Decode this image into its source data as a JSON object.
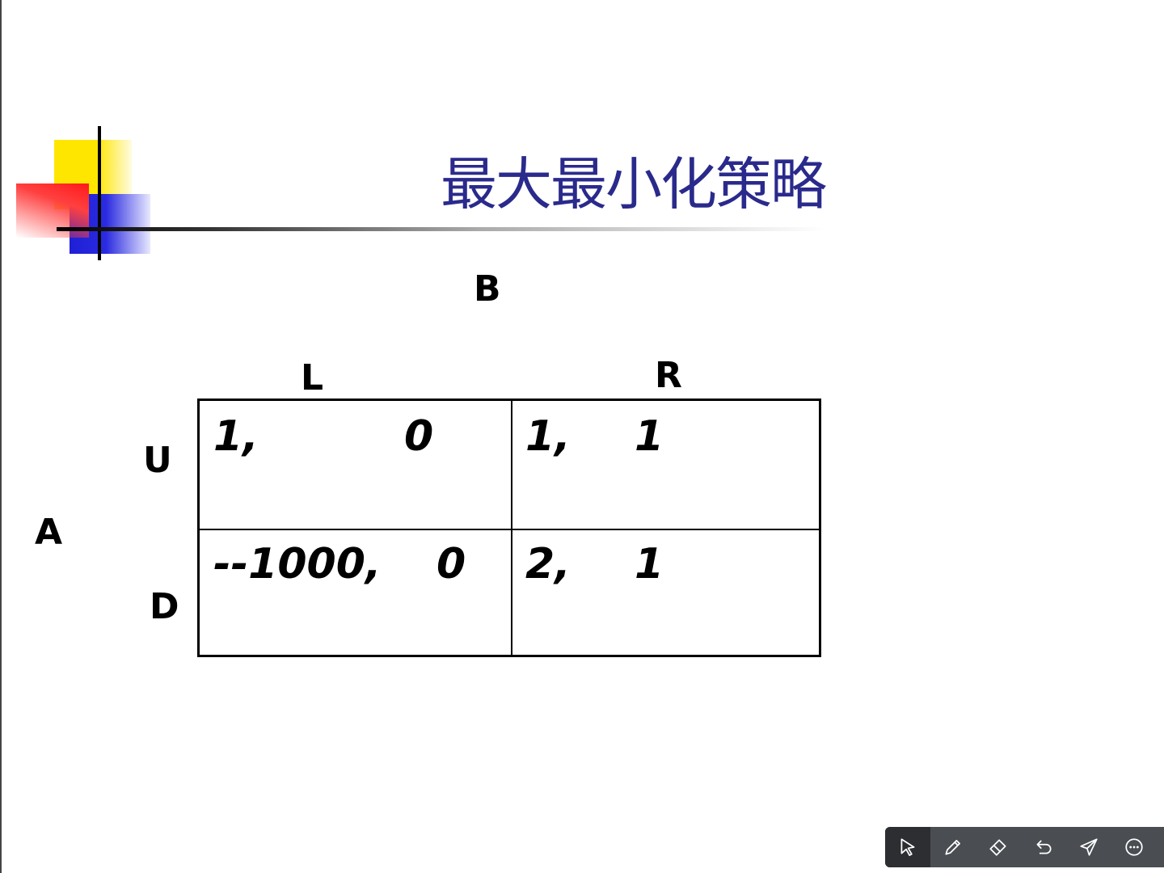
{
  "slide": {
    "title": "最大最小化策略",
    "player_b": "B",
    "player_a": "A",
    "columns": [
      "L",
      "R"
    ],
    "rows": [
      "U",
      "D"
    ],
    "cells": {
      "ul": {
        "a": "1,",
        "b": "0"
      },
      "ur": {
        "a": "1,",
        "b": "1"
      },
      "dl": {
        "a": "--1000,",
        "b": "0"
      },
      "dr": {
        "a": "2,",
        "b": "1"
      }
    },
    "colors": {
      "title": "#2a2a8c",
      "logo_yellow": "#ffe600",
      "logo_red": "#ff1a1a",
      "logo_blue": "#1f1fd6"
    }
  },
  "toolbar": {
    "tools": [
      "pointer-icon",
      "pen-icon",
      "eraser-icon",
      "undo-icon",
      "send-icon",
      "more-icon"
    ]
  }
}
